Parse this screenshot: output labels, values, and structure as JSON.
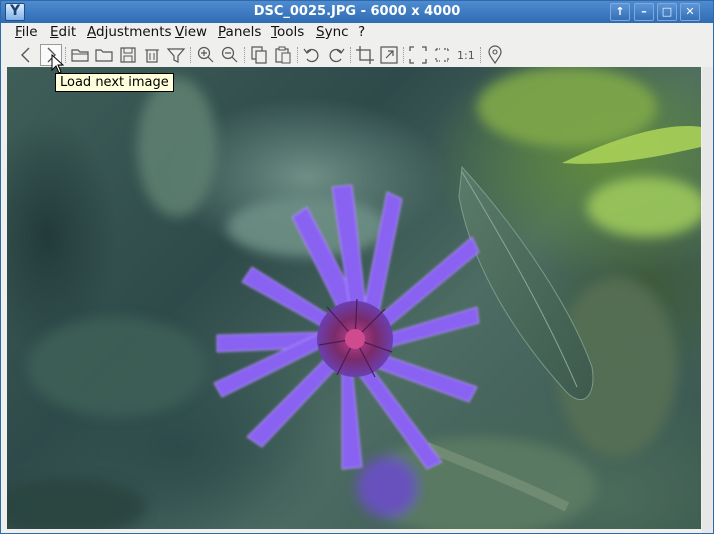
{
  "window": {
    "title": "DSC_0025.JPG  - 6000 x 4000",
    "buttons": {
      "up": "↑",
      "minimize": "–",
      "maximize": "□",
      "close": "✕"
    }
  },
  "menu": [
    "File",
    "Edit",
    "Adjustments",
    "View",
    "Panels",
    "Tools",
    "Sync",
    "?"
  ],
  "toolbar": {
    "tools": [
      "previous-image-icon",
      "next-image-icon",
      "open-folder-icon",
      "open-icon",
      "save-icon",
      "delete-icon",
      "filter-icon",
      "zoom-in-icon",
      "zoom-out-icon",
      "copy-icon",
      "paste-icon",
      "rotate-left-icon",
      "rotate-right-icon",
      "crop-icon",
      "resize-icon",
      "fullscreen-icon",
      "fit-icon",
      "actual-size-icon",
      "location-icon"
    ],
    "actual_size_label": "1:1"
  },
  "tooltip": "Load next image",
  "colors": {
    "titlebar": "#3a78c0",
    "tooltip_bg": "#ffffdc",
    "petal": "#8a62f2"
  }
}
